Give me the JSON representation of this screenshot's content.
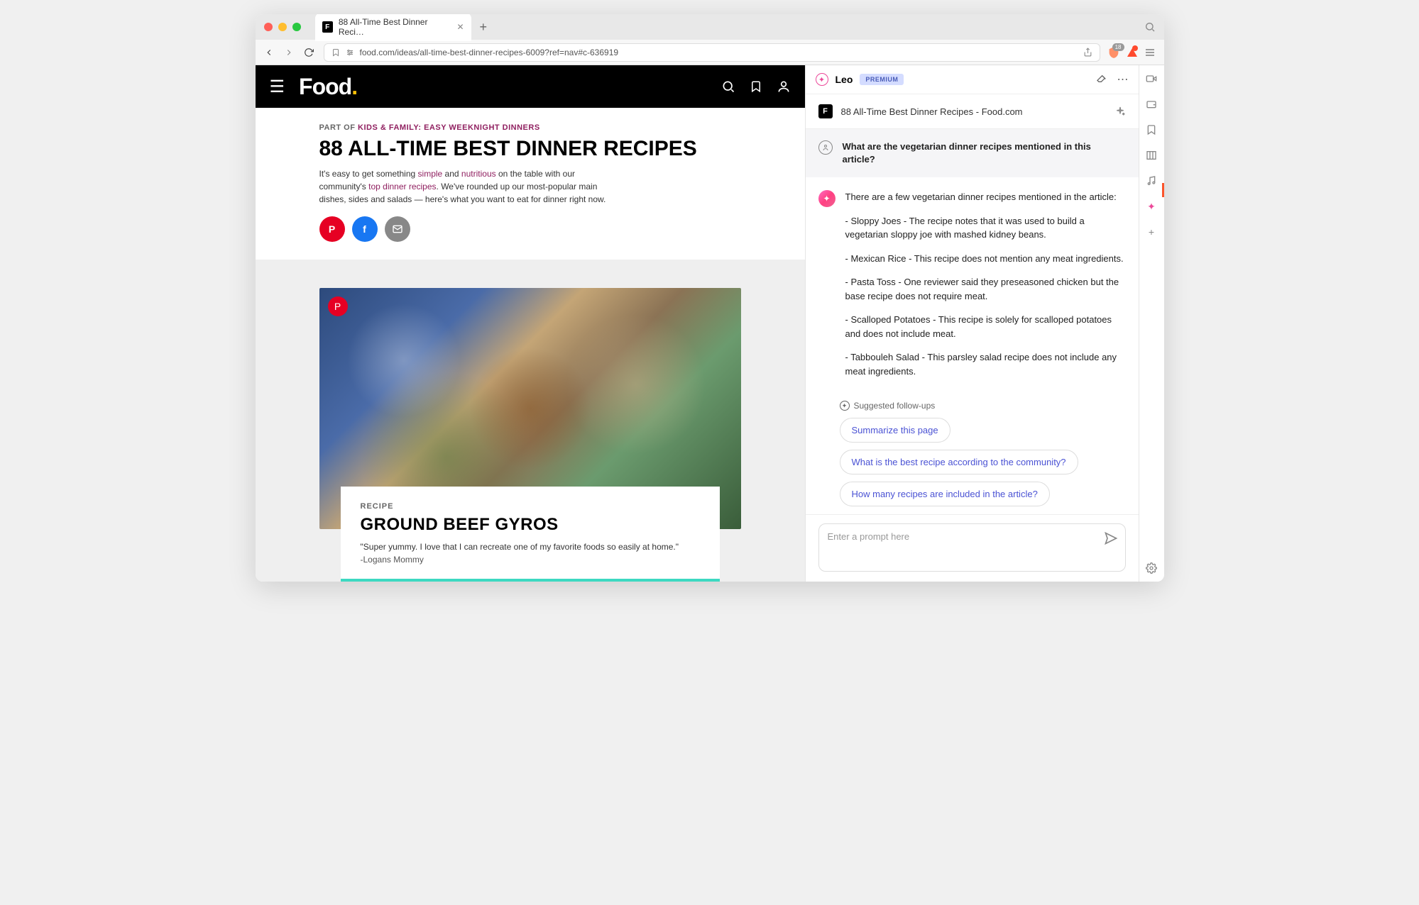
{
  "tab": {
    "title": "88 All-Time Best Dinner Reci…",
    "favicon_letter": "F"
  },
  "url": "food.com/ideas/all-time-best-dinner-recipes-6009?ref=nav#c-636919",
  "shield_count": "18",
  "food": {
    "logo_text": "Food",
    "part_of_prefix": "PART OF ",
    "part_of_link": "KIDS & FAMILY: EASY WEEKNIGHT DINNERS",
    "title": "88 ALL-TIME BEST DINNER RECIPES",
    "desc_1": "It's easy to get something ",
    "link_simple": "simple",
    "desc_2": " and ",
    "link_nutritious": "nutritious",
    "desc_3": " on the table with our community's ",
    "link_top": "top dinner recipes",
    "desc_4": ". We've rounded up our most-popular main dishes, sides and salads — here's what you want to eat for dinner right now.",
    "recipe_label": "RECIPE",
    "recipe_name": "GROUND BEEF GYROS",
    "recipe_quote": "\"Super yummy. I love that I can recreate one of my favorite foods so easily at home.\"",
    "recipe_author": "-Logans Mommy"
  },
  "leo": {
    "title": "Leo",
    "premium": "PREMIUM",
    "context": "88 All-Time Best Dinner Recipes - Food.com",
    "user_question": "What are the vegetarian dinner recipes mentioned in this article?",
    "answer_intro": "There are a few vegetarian dinner recipes mentioned in the article:",
    "answer_items": [
      "- Sloppy Joes - The recipe notes that it was used to build a vegetarian sloppy joe with mashed kidney beans.",
      "- Mexican Rice - This recipe does not mention any meat ingredients.",
      "- Pasta Toss - One reviewer said they preseasoned chicken but the base recipe does not require meat.",
      "- Scalloped Potatoes - This recipe is solely for scalloped potatoes and does not include meat.",
      "- Tabbouleh Salad - This parsley salad recipe does not include any meat ingredients."
    ],
    "suggested_label": "Suggested follow-ups",
    "suggestions": [
      "Summarize this page",
      "What is the best recipe according to the community?",
      "How many recipes are included in the article?"
    ],
    "input_placeholder": "Enter a prompt here"
  }
}
